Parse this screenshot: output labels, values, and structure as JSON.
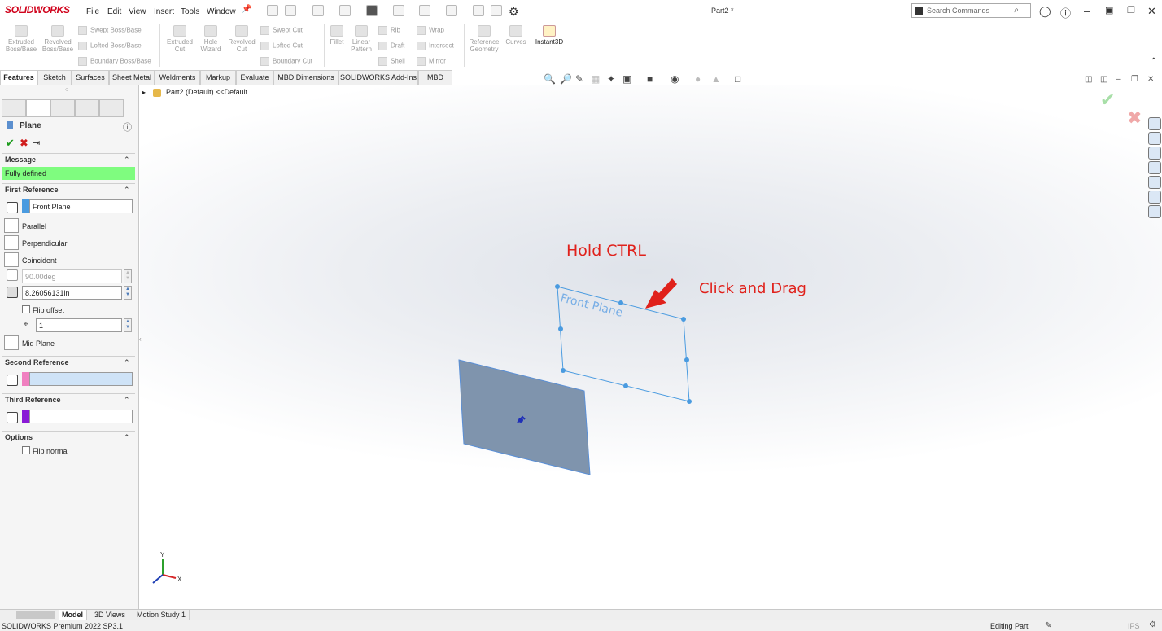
{
  "app": {
    "logo": "SOLIDWORKS",
    "document_title": "Part2 *"
  },
  "menu": [
    "File",
    "Edit",
    "View",
    "Insert",
    "Tools",
    "Window"
  ],
  "search": {
    "placeholder": "Search Commands"
  },
  "commands": {
    "extruded_boss": "Extruded\nBoss/Base",
    "revolved_boss": "Revolved\nBoss/Base",
    "swept_boss": "Swept Boss/Base",
    "lofted_boss": "Lofted Boss/Base",
    "boundary_boss": "Boundary Boss/Base",
    "extruded_cut": "Extruded\nCut",
    "hole_wizard": "Hole\nWizard",
    "revolved_cut": "Revolved\nCut",
    "swept_cut": "Swept Cut",
    "lofted_cut": "Lofted Cut",
    "boundary_cut": "Boundary Cut",
    "fillet": "Fillet",
    "linear_pattern": "Linear\nPattern",
    "rib": "Rib",
    "draft": "Draft",
    "shell": "Shell",
    "wrap": "Wrap",
    "intersect": "Intersect",
    "mirror": "Mirror",
    "reference_geometry": "Reference\nGeometry",
    "curves": "Curves",
    "instant3d": "Instant3D"
  },
  "tabs": [
    "Features",
    "Sketch",
    "Surfaces",
    "Sheet Metal",
    "Weldments",
    "Markup",
    "Evaluate",
    "MBD Dimensions",
    "SOLIDWORKS Add-Ins",
    "MBD"
  ],
  "tree": {
    "root": "Part2 (Default) <<Default..."
  },
  "property_manager": {
    "title": "Plane",
    "message_header": "Message",
    "message": "Fully defined",
    "first_reference": {
      "header": "First Reference",
      "value": "Front Plane",
      "options": [
        "Parallel",
        "Perpendicular",
        "Coincident"
      ],
      "angle": "90.00deg",
      "distance": "8.26056131in",
      "flip_offset": "Flip offset",
      "instances": "1",
      "mid_plane": "Mid Plane"
    },
    "second_reference": {
      "header": "Second Reference",
      "value": ""
    },
    "third_reference": {
      "header": "Third Reference",
      "value": ""
    },
    "options": {
      "header": "Options",
      "flip_normal": "Flip normal"
    }
  },
  "viewport": {
    "plane_label": "Front Plane",
    "annotation_ctrl": "Hold CTRL",
    "annotation_drag": "Click and Drag",
    "axis_x": "X",
    "axis_y": "Y"
  },
  "bottom_tabs": [
    "Model",
    "3D Views",
    "Motion Study 1"
  ],
  "status": {
    "left": "SOLIDWORKS Premium 2022 SP3.1",
    "right": "Editing Part",
    "units": "IPS"
  },
  "colors": {
    "accent_red": "#e0211b",
    "defined_green": "#7ffc7f",
    "plane_blue": "#4a9be0"
  }
}
